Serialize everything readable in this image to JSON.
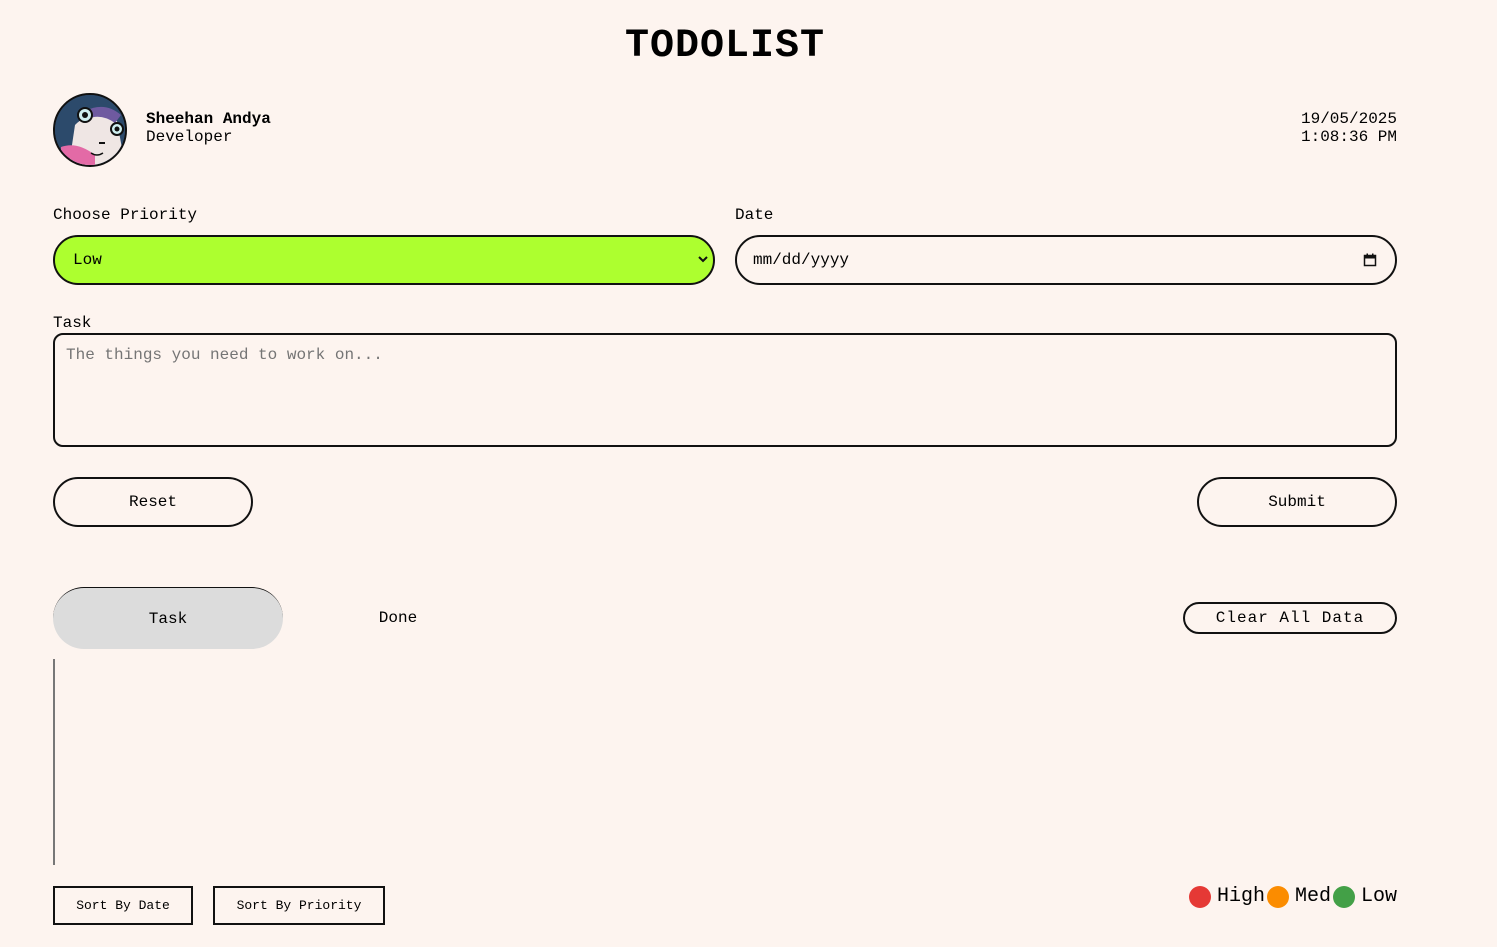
{
  "header": {
    "title": "TODOLIST"
  },
  "profile": {
    "name": "Sheehan Andya",
    "role": "Developer",
    "date": "19/05/2025",
    "time": "1:08:36 PM"
  },
  "form": {
    "priority_label": "Choose Priority",
    "priority_value": "Low",
    "priority_color": "#adff2f",
    "date_label": "Date",
    "date_placeholder": "mm/dd/yyyy",
    "task_label": "Task",
    "task_placeholder": "The things you need to work on...",
    "reset_label": "Reset",
    "submit_label": "Submit"
  },
  "tabs": {
    "task_label": "Task",
    "done_label": "Done",
    "active": "Task",
    "clear_label": "Clear All Data"
  },
  "sort": {
    "by_date_label": "Sort By Date",
    "by_priority_label": "Sort By Priority"
  },
  "legend": {
    "high_label": "High",
    "high_color": "#e53935",
    "med_label": "Med",
    "med_color": "#fb8c00",
    "low_label": "Low",
    "low_color": "#43a047"
  }
}
